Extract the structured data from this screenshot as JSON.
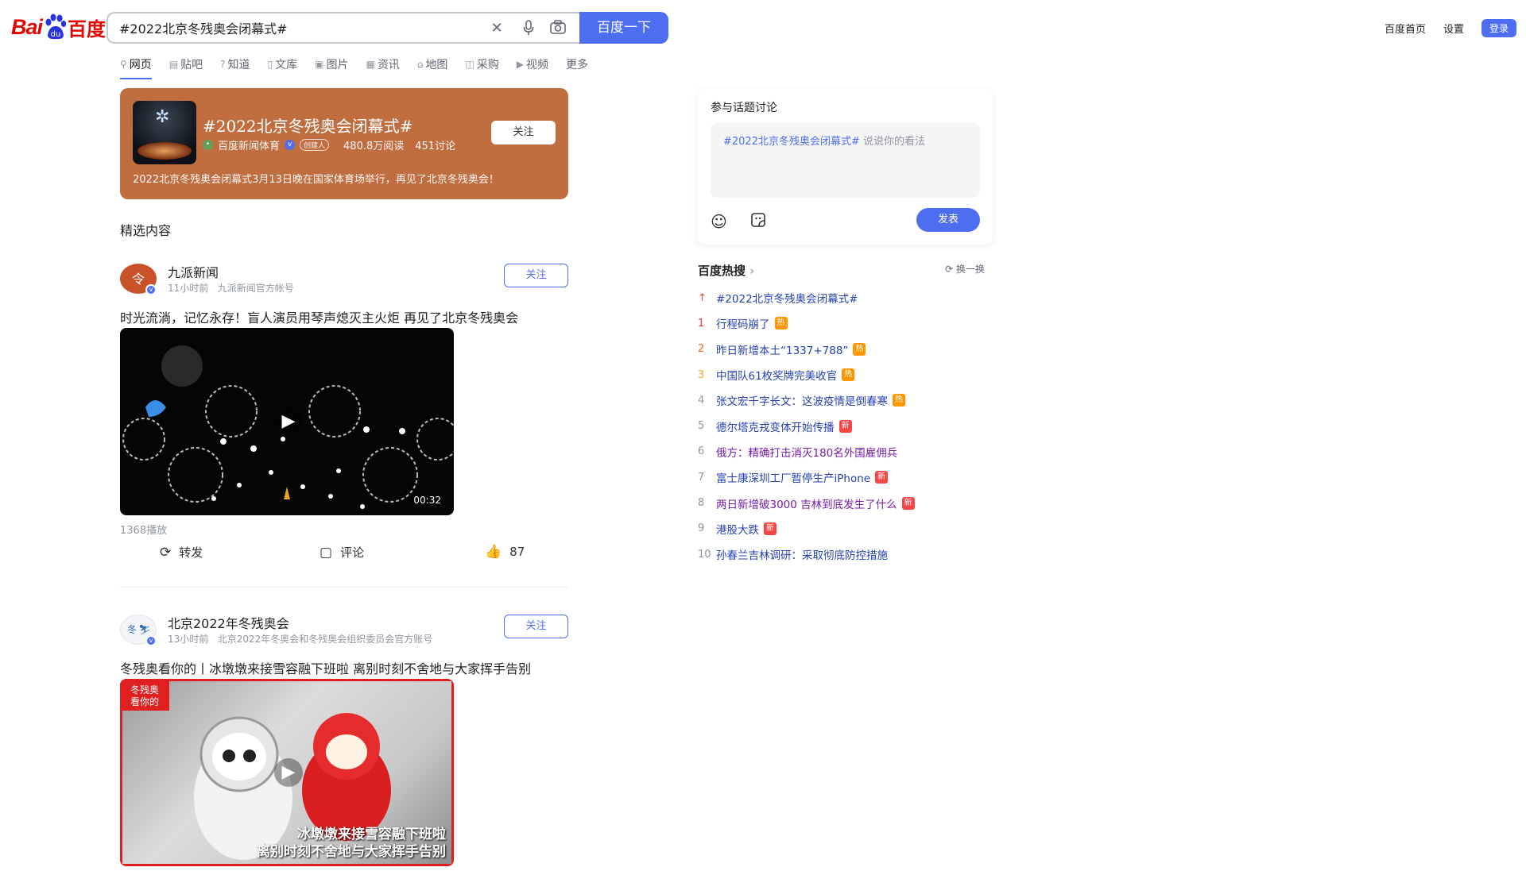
{
  "header": {
    "logo_left": "Bai",
    "logo_right": "百度",
    "search_value": "#2022北京冬残奥会闭幕式#",
    "search_button": "百度一下",
    "links": [
      "百度首页",
      "设置"
    ],
    "login": "登录"
  },
  "tabs": [
    {
      "label": "网页",
      "icon": "search-icon"
    },
    {
      "label": "贴吧",
      "icon": "tieba-icon"
    },
    {
      "label": "知道",
      "icon": "question-icon"
    },
    {
      "label": "文库",
      "icon": "document-icon"
    },
    {
      "label": "图片",
      "icon": "image-icon"
    },
    {
      "label": "资讯",
      "icon": "news-icon"
    },
    {
      "label": "地图",
      "icon": "map-icon"
    },
    {
      "label": "采购",
      "icon": "shopping-icon"
    },
    {
      "label": "视频",
      "icon": "video-icon"
    },
    {
      "label": "更多",
      "icon": ""
    }
  ],
  "topic": {
    "title": "#2022北京冬残奥会闭幕式#",
    "source": "百度新闻体育",
    "creator_tag": "创建人",
    "reads": "480.8万阅读",
    "discussions": "451讨论",
    "description": "2022北京冬残奥会闭幕式3月13日晚在国家体育场举行，再见了北京冬残奥会！",
    "follow": "关注",
    "accent": "#c06d3f"
  },
  "section_label": "精选内容",
  "posts": [
    {
      "name": "九派新闻",
      "time": "11小时前",
      "account": "九派新闻官方帐号",
      "follow": "关注",
      "title": "时光流淌，记忆永存！盲人演员用琴声熄灭主火炬 再见了北京冬残奥会",
      "duration": "00:32",
      "plays": "1368播放",
      "repost": "转发",
      "comment": "评论",
      "likes": "87"
    },
    {
      "name": "北京2022年冬残奥会",
      "time": "13小时前",
      "account": "北京2022年冬奥会和冬残奥会组织委员会官方账号",
      "follow": "关注",
      "title": "冬残奥看你的丨冰墩墩来接雪容融下班啦 离别时刻不舍地与大家挥手告别",
      "overlay_line1": "冰墩墩来接雪容融下班啦",
      "overlay_line2": "离别时刻不舍地与大家挥手告别"
    }
  ],
  "discuss": {
    "title": "参与话题讨论",
    "placeholder_tag": "#2022北京冬残奥会闭幕式#",
    "placeholder_text": " 说说你的看法",
    "submit": "发表"
  },
  "hot": {
    "title": "百度热搜",
    "refresh": "换一换",
    "items": [
      {
        "idx": "↑",
        "text": "#2022北京冬残奥会闭幕式#",
        "badge": ""
      },
      {
        "idx": "1",
        "text": "行程码崩了",
        "badge": "热"
      },
      {
        "idx": "2",
        "text": "昨日新增本土“1337+788”",
        "badge": "热"
      },
      {
        "idx": "3",
        "text": "中国队61枚奖牌完美收官",
        "badge": "热"
      },
      {
        "idx": "4",
        "text": "张文宏千字长文：这波疫情是倒春寒",
        "badge": "热"
      },
      {
        "idx": "5",
        "text": "德尔塔克戎变体开始传播",
        "badge": "新"
      },
      {
        "idx": "6",
        "text": "俄方：精确打击消灭180名外国雇佣兵",
        "badge": ""
      },
      {
        "idx": "7",
        "text": "富士康深圳工厂暂停生产iPhone",
        "badge": "新"
      },
      {
        "idx": "8",
        "text": "两日新增破3000 吉林到底发生了什么",
        "badge": "新"
      },
      {
        "idx": "9",
        "text": "港股大跌",
        "badge": "新"
      },
      {
        "idx": "10",
        "text": "孙春兰吉林调研：采取彻底防控措施",
        "badge": ""
      }
    ]
  },
  "colors": {
    "brand_blue": "#4e6ef2",
    "brand_red": "#e10601",
    "link": "#2440b3"
  }
}
